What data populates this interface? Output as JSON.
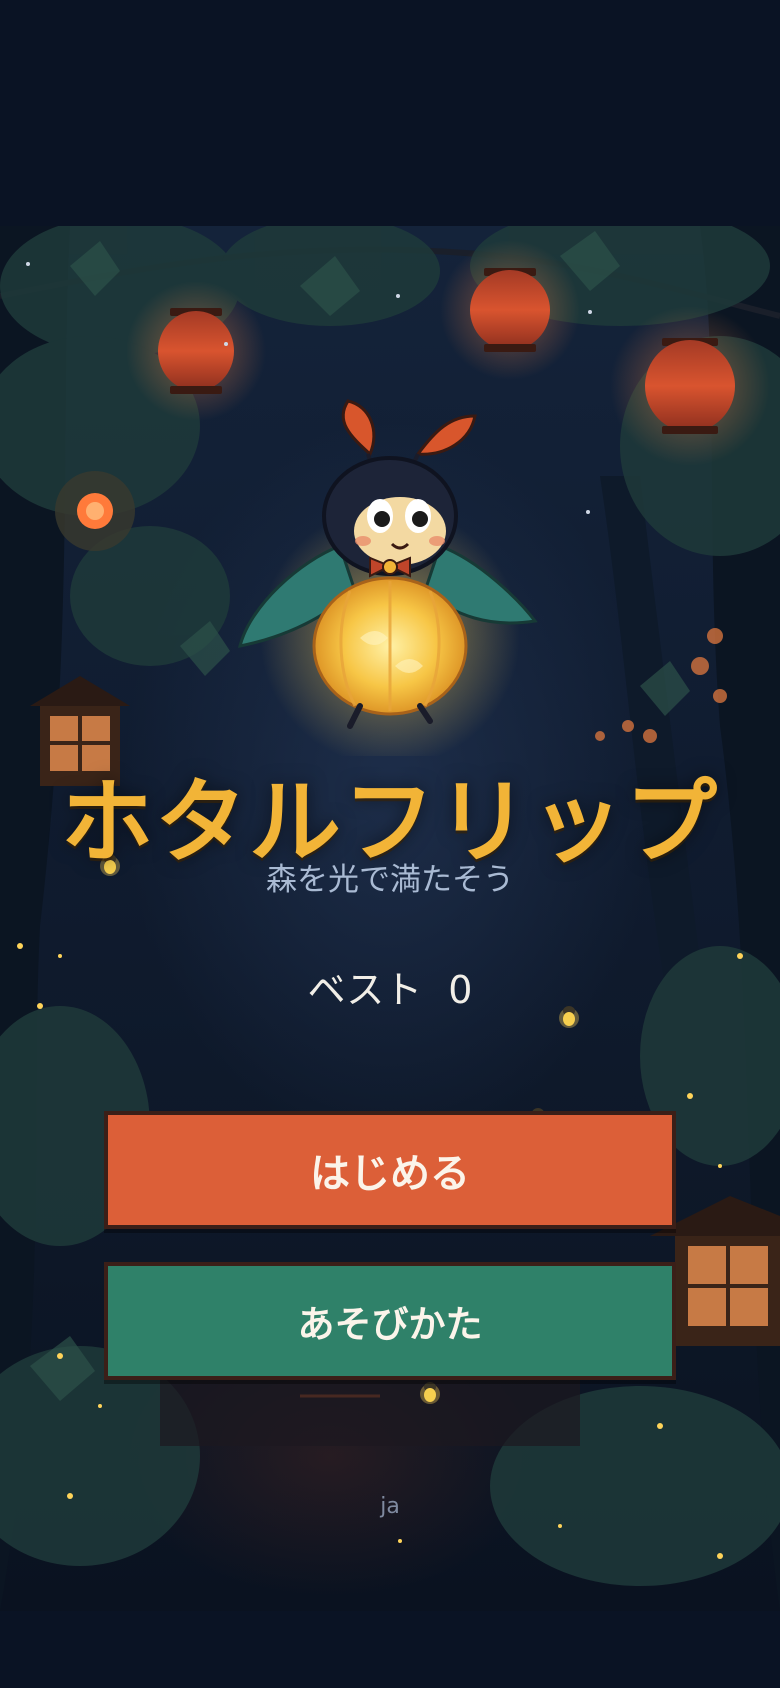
{
  "game": {
    "title": "ホタルフリップ",
    "subtitle": "森を光で満たそう",
    "best_label": "ベスト",
    "best_value": "0",
    "start_label": "はじめる",
    "howto_label": "あそびかた",
    "language": "ja"
  },
  "colors": {
    "title": "#f2b437",
    "start_button": "#dc5f38",
    "howto_button": "#2f8169",
    "background": "#0a1324"
  },
  "icons": [
    "firefly-mascot",
    "paper-lantern",
    "firefly",
    "leaf"
  ]
}
